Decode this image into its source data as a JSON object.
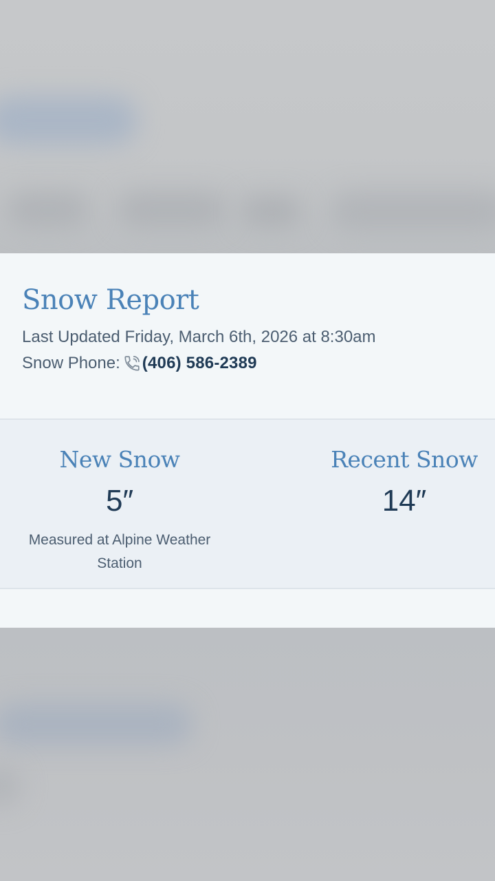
{
  "snow_report": {
    "title": "Snow Report",
    "last_updated": "Last Updated Friday, March 6th, 2026 at 8:30am",
    "phone_label": "Snow Phone:",
    "phone_icon": "phone-icon",
    "phone_number": "(406) 586-2389"
  },
  "stats": {
    "new_snow": {
      "label": "New Snow",
      "value": "5″",
      "note": "Measured at Alpine Weather Station"
    },
    "recent_snow": {
      "label": "Recent Snow",
      "value": "14″"
    }
  },
  "colors": {
    "heading_blue": "#4a82b7",
    "value_navy": "#1f3a55",
    "text_gray": "#4b5d70",
    "card_bg": "#f3f7f9",
    "stats_bg": "#ebf0f5"
  }
}
